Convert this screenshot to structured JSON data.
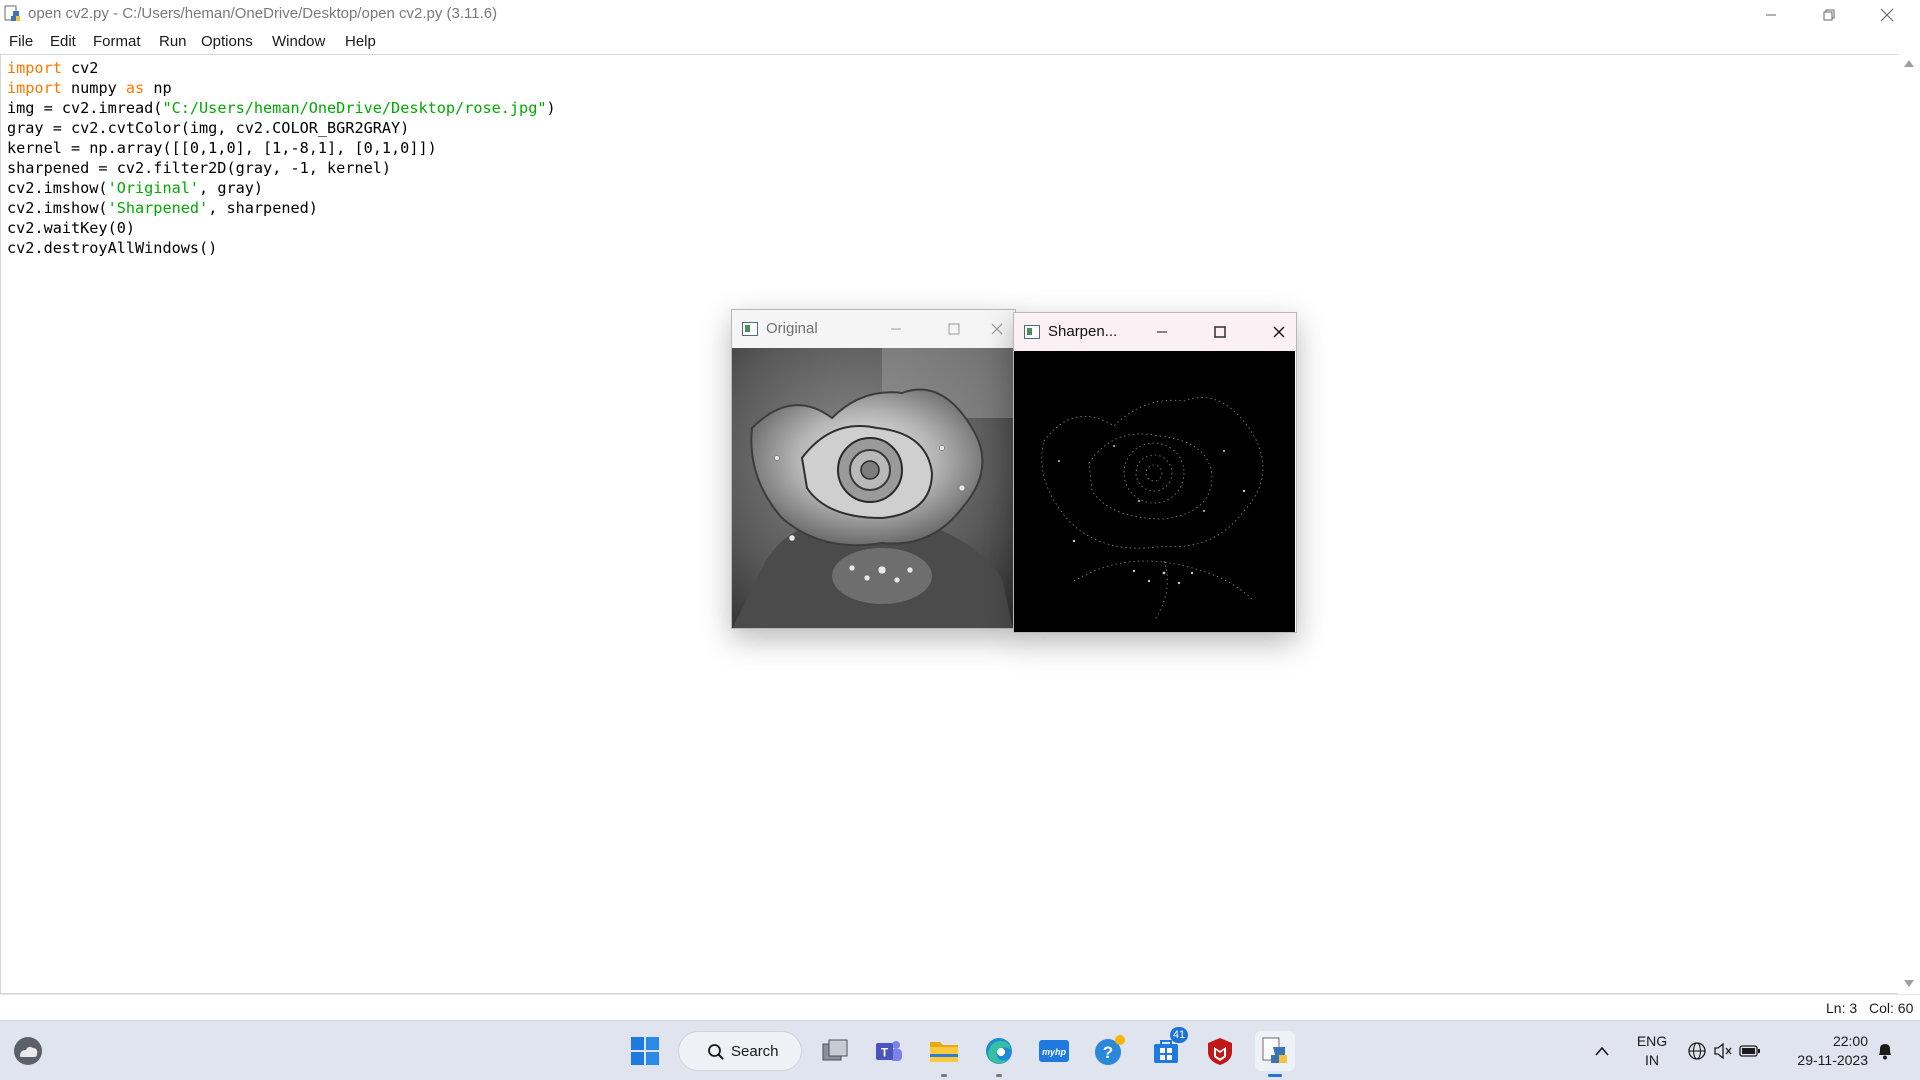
{
  "window": {
    "title": "open cv2.py - C:/Users/heman/OneDrive/Desktop/open cv2.py (3.11.6)",
    "minimize_symbol": "—",
    "restore_symbol": "❐",
    "close_symbol": "✕"
  },
  "menu": {
    "items": [
      "File",
      "Edit",
      "Format",
      "Run",
      "Options",
      "Window",
      "Help"
    ]
  },
  "editor": {
    "lines": [
      [
        {
          "t": "import",
          "c": "kw"
        },
        {
          "t": " cv2",
          "c": ""
        }
      ],
      [
        {
          "t": "import",
          "c": "kw"
        },
        {
          "t": " numpy ",
          "c": ""
        },
        {
          "t": "as",
          "c": "kw"
        },
        {
          "t": " np",
          "c": ""
        }
      ],
      [
        {
          "t": "img = cv2.imread(",
          "c": ""
        },
        {
          "t": "\"C:/Users/heman/OneDrive/Desktop/rose.jpg\"",
          "c": "str"
        },
        {
          "t": ")",
          "c": ""
        }
      ],
      [
        {
          "t": "gray = cv2.cvtColor(img, cv2.COLOR_BGR2GRAY)",
          "c": ""
        }
      ],
      [
        {
          "t": "kernel = np.array([[0,1,0], [1,-8,1], [0,1,0]])",
          "c": ""
        }
      ],
      [
        {
          "t": "sharpened = cv2.filter2D(gray, -1, kernel)",
          "c": ""
        }
      ],
      [
        {
          "t": "cv2.imshow(",
          "c": ""
        },
        {
          "t": "'Original'",
          "c": "str"
        },
        {
          "t": ", gray)",
          "c": ""
        }
      ],
      [
        {
          "t": "cv2.imshow(",
          "c": ""
        },
        {
          "t": "'Sharpened'",
          "c": "str"
        },
        {
          "t": ", sharpened)",
          "c": ""
        }
      ],
      [
        {
          "t": "cv2.waitKey(0)",
          "c": ""
        }
      ],
      [
        {
          "t": "cv2.destroyAllWindows()",
          "c": ""
        }
      ]
    ],
    "colors": {
      "keyword": "#ff7700",
      "string": "#00aa00",
      "text": "#000000"
    }
  },
  "status": {
    "line": "Ln: 3",
    "col": "Col: 60"
  },
  "cv_windows": {
    "original": {
      "title": "Original"
    },
    "sharpened": {
      "title": "Sharpen..."
    }
  },
  "taskbar": {
    "search_label": "Search",
    "mail_badge": "41",
    "lang_primary": "ENG",
    "lang_secondary": "IN",
    "time": "22:00",
    "date": "29-11-2023",
    "myhp_label": "myhp",
    "help_label": "?"
  }
}
